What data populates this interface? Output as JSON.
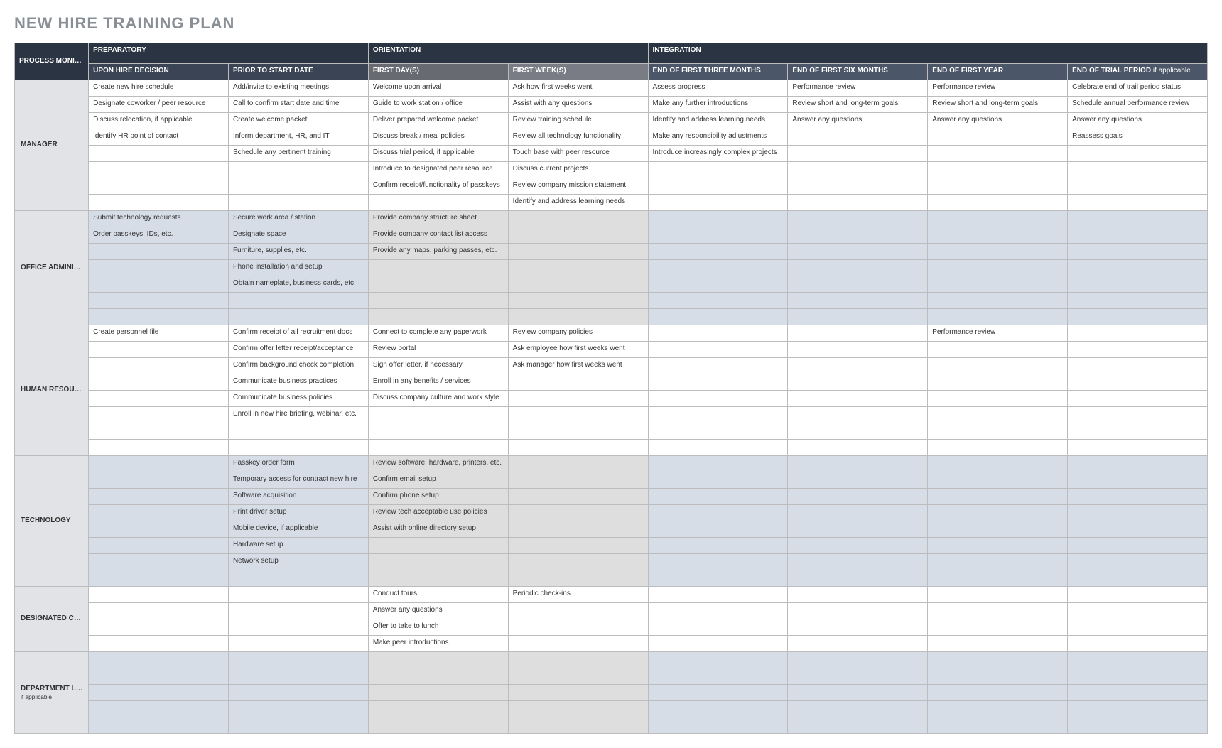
{
  "title": "NEW HIRE TRAINING PLAN",
  "corner_header": "PROCESS MONITOR / MENTOR",
  "phases": {
    "preparatory": "PREPARATORY",
    "orientation": "ORIENTATION",
    "integration": "INTEGRATION"
  },
  "columns": {
    "upon_hire": "UPON HIRE DECISION",
    "prior_start": "PRIOR TO START DATE",
    "first_day": "FIRST DAY(S)",
    "first_week": "FIRST WEEK(S)",
    "three_months": "END OF FIRST THREE MONTHS",
    "six_months": "END OF FIRST SIX MONTHS",
    "first_year": "END OF FIRST YEAR",
    "trial_period": "END OF TRIAL PERIOD",
    "trial_period_note": "if applicable"
  },
  "roles": [
    {
      "name": "MANAGER",
      "shade": "white",
      "row_count": 8,
      "rows": [
        [
          "Create new hire schedule",
          "Add/invite to existing meetings",
          "Welcome upon arrival",
          "Ask how first weeks went",
          "Assess progress",
          "Performance review",
          "Performance review",
          "Celebrate end of trail period status"
        ],
        [
          "Designate coworker / peer resource",
          "Call to confirm start date and time",
          "Guide to work station / office",
          "Assist with any questions",
          "Make any further introductions",
          "Review short and long-term goals",
          "Review short and long-term goals",
          "Schedule annual performance review"
        ],
        [
          "Discuss relocation, if applicable",
          "Create welcome packet",
          "Deliver prepared welcome packet",
          "Review training schedule",
          "Identify and address learning needs",
          "Answer any questions",
          "Answer any questions",
          "Answer any questions"
        ],
        [
          "Identify HR point of contact",
          "Inform department, HR, and IT",
          "Discuss break / meal policies",
          "Review all technology functionality",
          "Make any responsibility adjustments",
          "",
          "",
          "Reassess goals"
        ],
        [
          "",
          "Schedule any pertinent training",
          "Discuss trial period, if applicable",
          "Touch base with peer resource",
          "Introduce increasingly complex projects",
          "",
          "",
          ""
        ],
        [
          "",
          "",
          "Introduce to designated peer resource",
          "Discuss current projects",
          "",
          "",
          "",
          ""
        ],
        [
          "",
          "",
          "Confirm receipt/functionality of passkeys",
          "Review company mission statement",
          "",
          "",
          "",
          ""
        ],
        [
          "",
          "",
          "",
          "Identify and address learning needs",
          "",
          "",
          "",
          ""
        ]
      ]
    },
    {
      "name": "OFFICE ADMINISTRATOR",
      "shade": "tint",
      "row_count": 7,
      "rows": [
        [
          "Submit technology requests",
          "Secure work area / station",
          "Provide company structure sheet",
          "",
          "",
          "",
          "",
          ""
        ],
        [
          "Order passkeys, IDs, etc.",
          "Designate space",
          "Provide company contact list access",
          "",
          "",
          "",
          "",
          ""
        ],
        [
          "",
          "Furniture, supplies, etc.",
          "Provide any maps, parking passes, etc.",
          "",
          "",
          "",
          "",
          ""
        ],
        [
          "",
          "Phone installation and setup",
          "",
          "",
          "",
          "",
          "",
          ""
        ],
        [
          "",
          "Obtain nameplate, business cards, etc.",
          "",
          "",
          "",
          "",
          "",
          ""
        ],
        [
          "",
          "",
          "",
          "",
          "",
          "",
          "",
          ""
        ],
        [
          "",
          "",
          "",
          "",
          "",
          "",
          "",
          ""
        ]
      ]
    },
    {
      "name": "HUMAN RESOURCES",
      "shade": "white",
      "row_count": 8,
      "rows": [
        [
          "Create personnel file",
          "Confirm receipt of all recruitment docs",
          "Connect to complete any paperwork",
          "Review company policies",
          "",
          "",
          "Performance review",
          ""
        ],
        [
          "",
          "Confirm offer letter receipt/acceptance",
          "Review portal",
          "Ask employee how first weeks went",
          "",
          "",
          "",
          ""
        ],
        [
          "",
          "Confirm background check completion",
          "Sign offer letter, if necessary",
          "Ask manager how first weeks went",
          "",
          "",
          "",
          ""
        ],
        [
          "",
          "Communicate business practices",
          "Enroll in any benefits / services",
          "",
          "",
          "",
          "",
          ""
        ],
        [
          "",
          "Communicate business policies",
          "Discuss company culture and work style",
          "",
          "",
          "",
          "",
          ""
        ],
        [
          "",
          "Enroll in new hire briefing, webinar, etc.",
          "",
          "",
          "",
          "",
          "",
          ""
        ],
        [
          "",
          "",
          "",
          "",
          "",
          "",
          "",
          ""
        ],
        [
          "",
          "",
          "",
          "",
          "",
          "",
          "",
          ""
        ]
      ]
    },
    {
      "name": "TECHNOLOGY",
      "shade": "tint",
      "row_count": 8,
      "rows": [
        [
          "",
          "Passkey order form",
          "Review software, hardware, printers, etc.",
          "",
          "",
          "",
          "",
          ""
        ],
        [
          "",
          "Temporary access for contract new hire",
          "Confirm email setup",
          "",
          "",
          "",
          "",
          ""
        ],
        [
          "",
          "Software acquisition",
          "Confirm phone setup",
          "",
          "",
          "",
          "",
          ""
        ],
        [
          "",
          "Print driver setup",
          "Review tech acceptable use policies",
          "",
          "",
          "",
          "",
          ""
        ],
        [
          "",
          "Mobile device, if applicable",
          "Assist with online directory setup",
          "",
          "",
          "",
          "",
          ""
        ],
        [
          "",
          "Hardware setup",
          "",
          "",
          "",
          "",
          "",
          ""
        ],
        [
          "",
          "Network setup",
          "",
          "",
          "",
          "",
          "",
          ""
        ],
        [
          "",
          "",
          "",
          "",
          "",
          "",
          "",
          ""
        ]
      ]
    },
    {
      "name": "DESIGNATED COWORKER / PEER RESOURCE",
      "shade": "white",
      "row_count": 4,
      "rows": [
        [
          "",
          "",
          "Conduct tours",
          "Periodic check-ins",
          "",
          "",
          "",
          ""
        ],
        [
          "",
          "",
          "Answer any questions",
          "",
          "",
          "",
          "",
          ""
        ],
        [
          "",
          "",
          "Offer to take to lunch",
          "",
          "",
          "",
          "",
          ""
        ],
        [
          "",
          "",
          "Make peer introductions",
          "",
          "",
          "",
          "",
          ""
        ]
      ]
    },
    {
      "name": "DEPARTMENT LEAD",
      "name_note": "if applicable",
      "shade": "tint",
      "row_count": 5,
      "rows": [
        [
          "",
          "",
          "",
          "",
          "",
          "",
          "",
          ""
        ],
        [
          "",
          "",
          "",
          "",
          "",
          "",
          "",
          ""
        ],
        [
          "",
          "",
          "",
          "",
          "",
          "",
          "",
          ""
        ],
        [
          "",
          "",
          "",
          "",
          "",
          "",
          "",
          ""
        ],
        [
          "",
          "",
          "",
          "",
          "",
          "",
          "",
          ""
        ]
      ]
    }
  ]
}
